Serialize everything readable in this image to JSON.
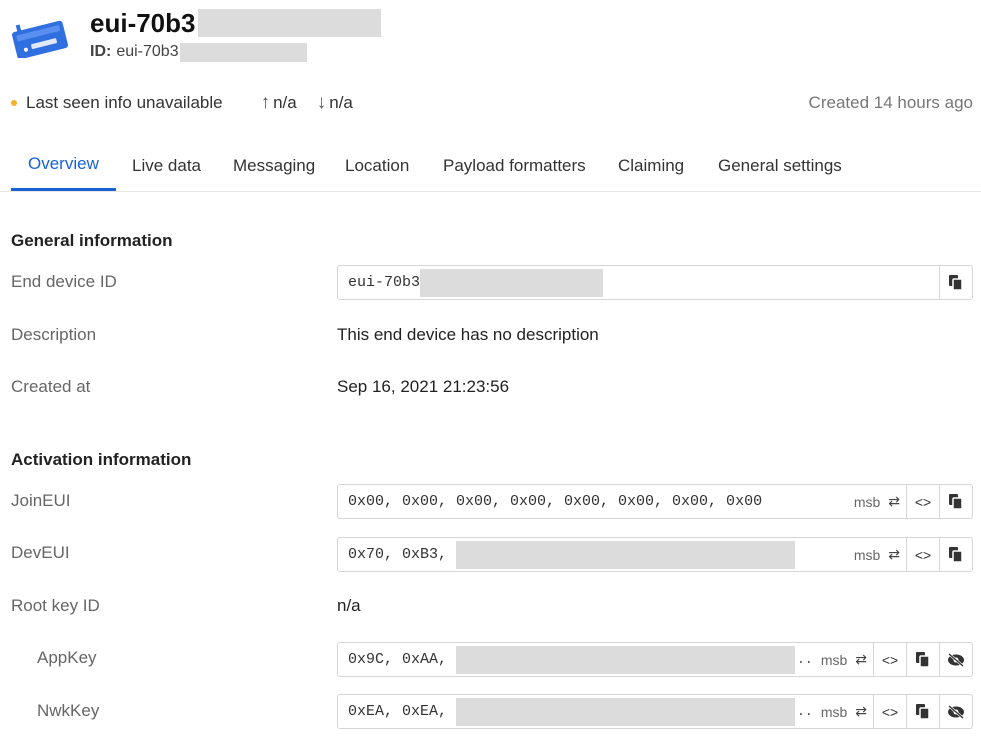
{
  "header": {
    "title": "eui-70b3",
    "id_label": "ID:",
    "id_value": "eui-70b3"
  },
  "status": {
    "last_seen": "Last seen info unavailable",
    "uplink": "n/a",
    "downlink": "n/a",
    "created": "Created 14 hours ago",
    "dot_color": "#f5b12b"
  },
  "tabs": [
    {
      "label": "Overview",
      "active": true
    },
    {
      "label": "Live data"
    },
    {
      "label": "Messaging"
    },
    {
      "label": "Location"
    },
    {
      "label": "Payload formatters"
    },
    {
      "label": "Claiming"
    },
    {
      "label": "General settings"
    }
  ],
  "general": {
    "title": "General information",
    "end_device_id_label": "End device ID",
    "end_device_id_value": "eui-70b3",
    "description_label": "Description",
    "description_value": "This end device has no description",
    "created_at_label": "Created at",
    "created_at_value": "Sep 16, 2021 21:23:56"
  },
  "activation": {
    "title": "Activation information",
    "join_eui_label": "JoinEUI",
    "join_eui_value": "0x00, 0x00, 0x00, 0x00, 0x00, 0x00, 0x00, 0x00",
    "dev_eui_label": "DevEUI",
    "dev_eui_value": "0x70, 0xB3, ",
    "root_key_id_label": "Root key ID",
    "root_key_id_value": "n/a",
    "app_key_label": "AppKey",
    "app_key_value": "0x9C, 0xAA, ",
    "nwk_key_label": "NwkKey",
    "nwk_key_value": "0xEA, 0xEA, ",
    "byte_order": "msb",
    "ellipsis": ".."
  },
  "colors": {
    "accent": "#1a62d3",
    "device_icon": "#2f6fe0"
  }
}
